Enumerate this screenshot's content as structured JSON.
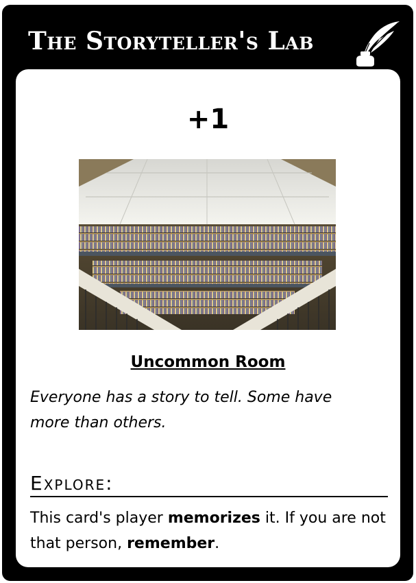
{
  "card": {
    "title": "The Storyteller's Lab",
    "header_icon": "quill-inkwell-icon",
    "cost": "+1",
    "image": "library-atrium-bookshelves",
    "room_type": "Uncommon Room",
    "flavor_text": "Everyone has a story to tell. Some have more than others.",
    "section_heading": "Explore:",
    "rules": {
      "p1": "This card's player ",
      "b1": "memorizes",
      "p2": " it. If you are not that person, ",
      "b2": "remember",
      "p3": "."
    },
    "colors": {
      "frame": "#000000",
      "panel": "#ffffff",
      "text": "#000000"
    }
  }
}
